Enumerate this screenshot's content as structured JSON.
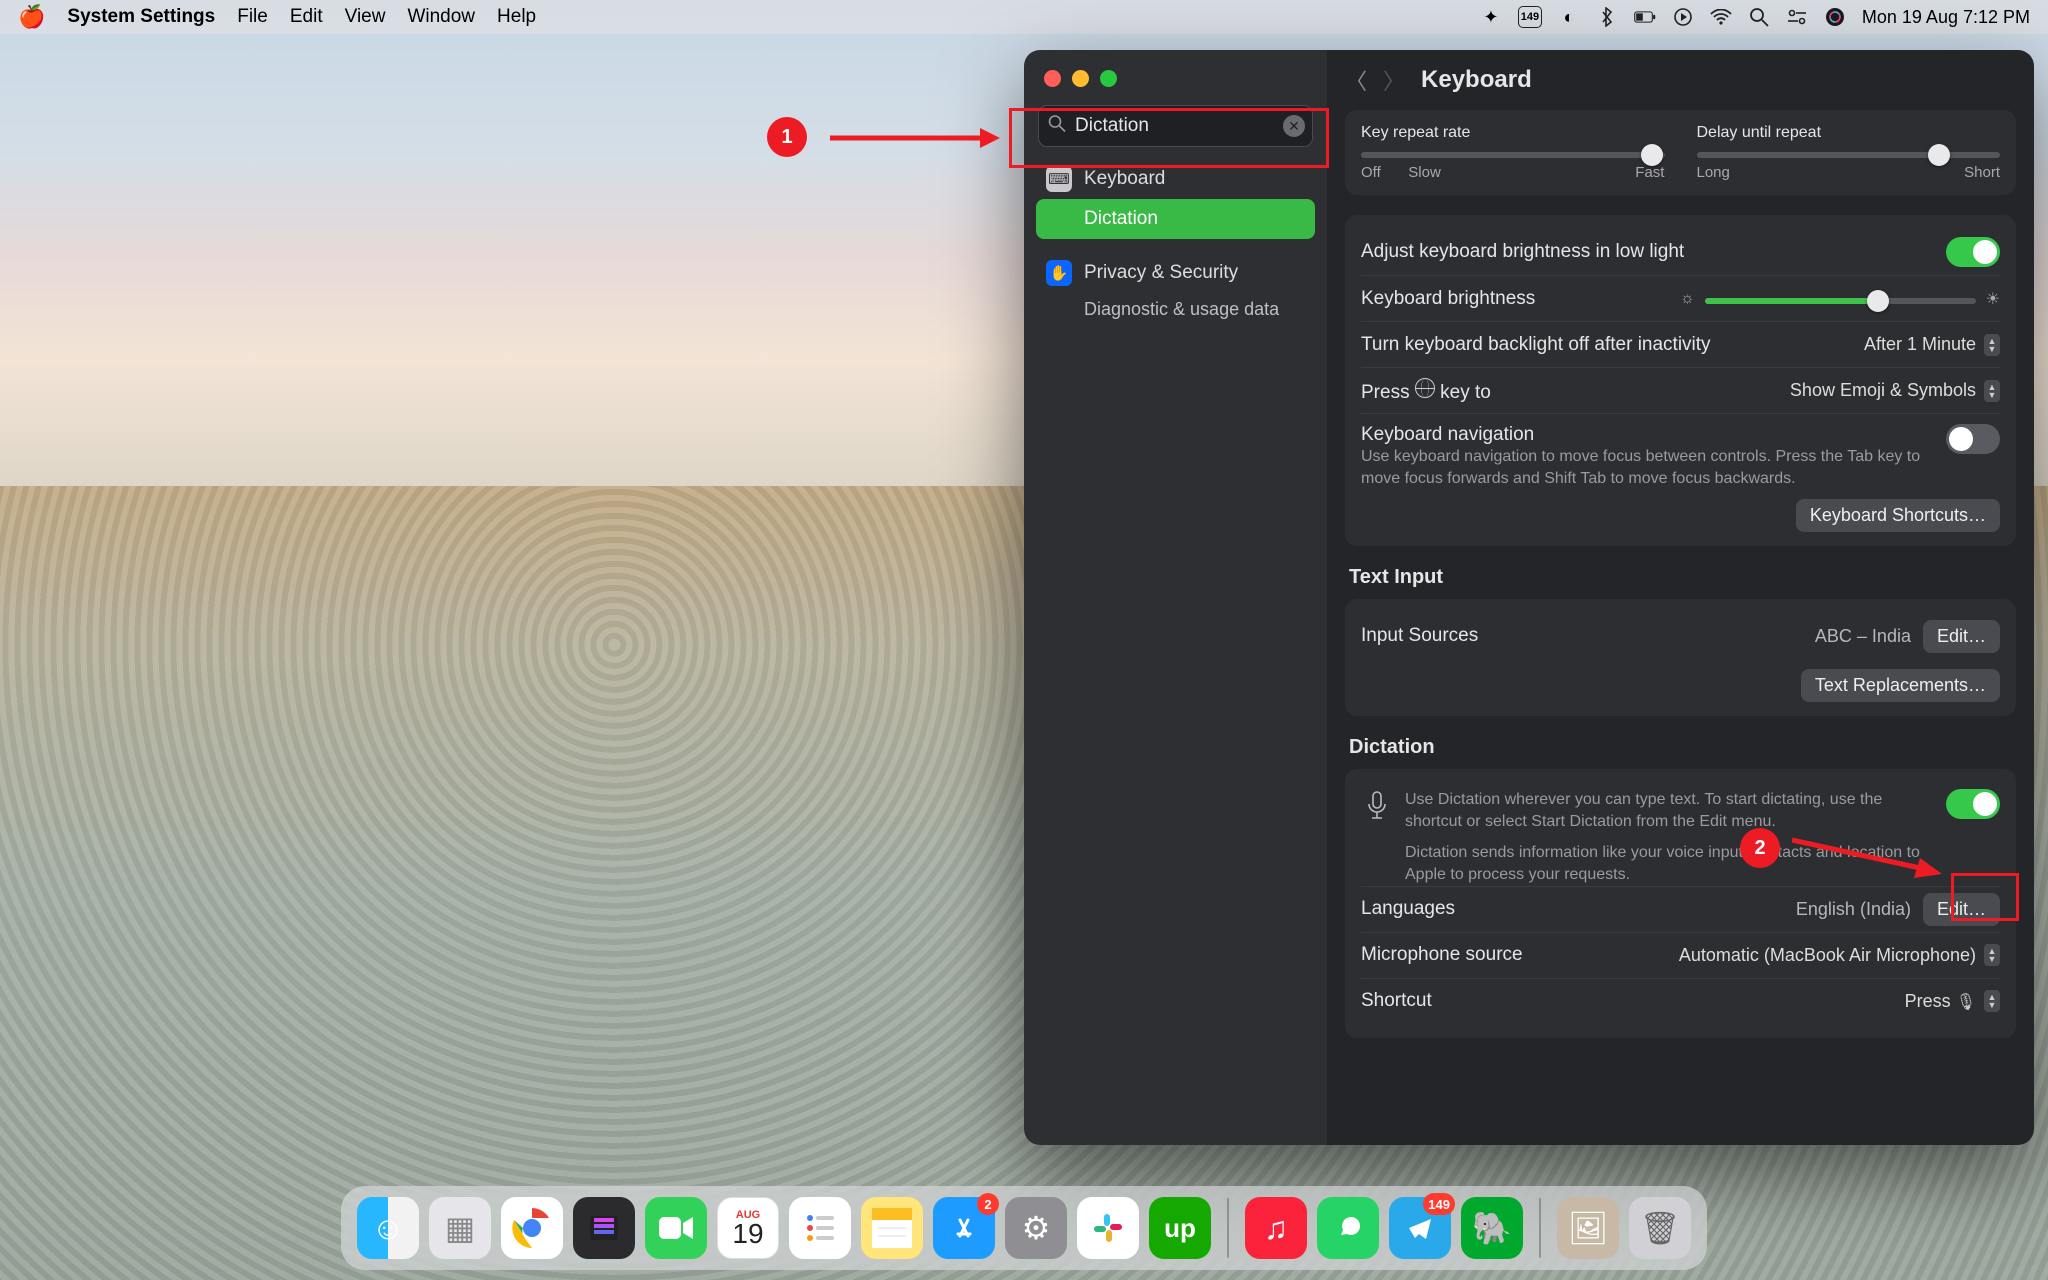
{
  "menubar": {
    "app": "System Settings",
    "items": [
      "File",
      "Edit",
      "View",
      "Window",
      "Help"
    ],
    "status_badge": "149",
    "datetime": "Mon 19 Aug  7:12 PM"
  },
  "annotations": {
    "one": "1",
    "two": "2"
  },
  "sidebar": {
    "search_value": "Dictation",
    "items": {
      "keyboard": "Keyboard",
      "dictation": "Dictation",
      "privacy": "Privacy & Security",
      "diag": "Diagnostic & usage data"
    }
  },
  "title": "Keyboard",
  "sliders": {
    "repeat_label": "Key repeat rate",
    "repeat_left": "Off",
    "repeat_mid": "Slow",
    "repeat_right": "Fast",
    "delay_label": "Delay until repeat",
    "delay_left": "Long",
    "delay_right": "Short"
  },
  "rows": {
    "adjust_bright": "Adjust keyboard brightness in low light",
    "kbd_bright": "Keyboard brightness",
    "backlight_off": "Turn keyboard backlight off after inactivity",
    "backlight_value": "After 1 Minute",
    "press_key": "Press 🌐 key to",
    "press_key_label": "Press",
    "press_key_suffix": "key to",
    "press_value": "Show Emoji & Symbols",
    "kbd_nav": "Keyboard navigation",
    "kbd_nav_desc": "Use keyboard navigation to move focus between controls. Press the Tab key to move focus forwards and Shift Tab to move focus backwards.",
    "kbd_shortcuts_btn": "Keyboard Shortcuts…"
  },
  "text_input": {
    "heading": "Text Input",
    "sources_label": "Input Sources",
    "sources_value": "ABC – India",
    "edit_btn": "Edit…",
    "replacements_btn": "Text Replacements…"
  },
  "dictation": {
    "heading": "Dictation",
    "desc1": "Use Dictation wherever you can type text. To start dictating, use the shortcut or select Start Dictation from the Edit menu.",
    "desc2": "Dictation sends information like your voice input, contacts and location to Apple to process your requests.",
    "lang_label": "Languages",
    "lang_value": "English (India)",
    "edit_btn": "Edit…",
    "mic_label": "Microphone source",
    "mic_value": "Automatic (MacBook Air Microphone)",
    "shortcut_label": "Shortcut",
    "shortcut_value": "Press 🎤"
  },
  "dock": {
    "cal_month": "AUG",
    "cal_day": "19",
    "appstore_badge": "2",
    "telegram_badge": "149"
  }
}
